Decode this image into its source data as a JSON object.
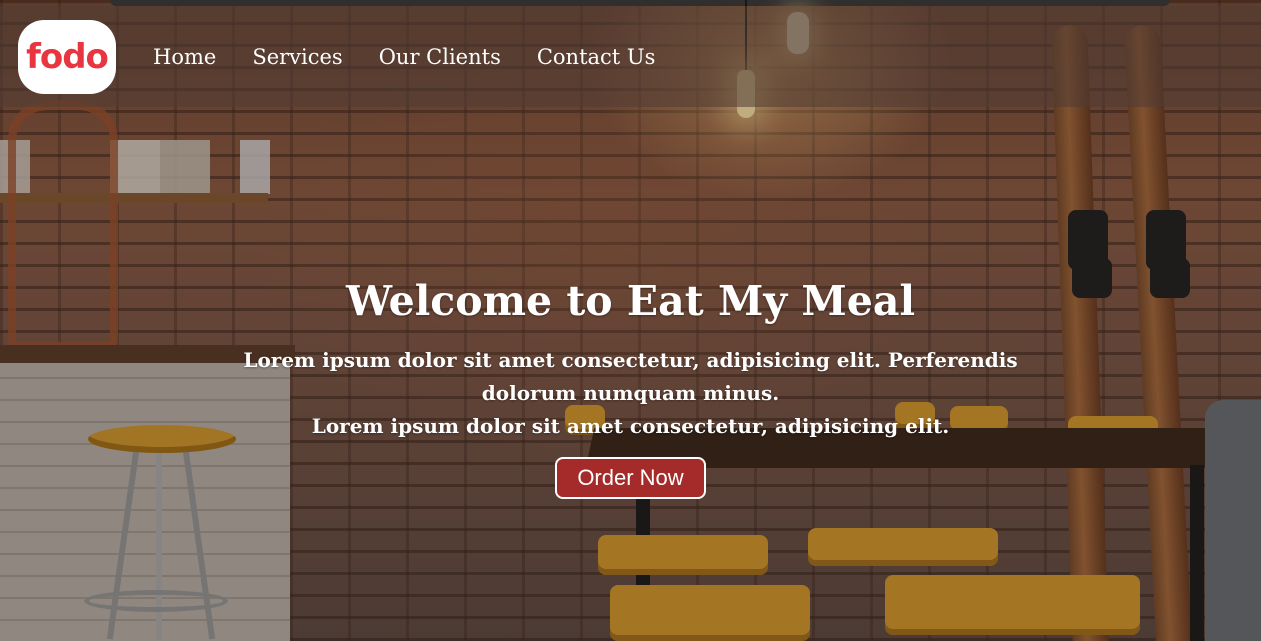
{
  "brand": {
    "logo_text": "fodo",
    "logo_color": "#e8353f"
  },
  "nav": {
    "items": [
      {
        "label": "Home"
      },
      {
        "label": "Services"
      },
      {
        "label": "Our Clients"
      },
      {
        "label": "Contact Us"
      }
    ]
  },
  "hero": {
    "title": "Welcome to Eat My Meal",
    "line1": "Lorem ipsum dolor sit amet consectetur, adipisicing elit. Perferendis dolorum numquam minus.",
    "line2": "Lorem ipsum dolor sit amet consectetur, adipisicing elit.",
    "button_label": "Order Now",
    "button_color": "#a52a2a"
  }
}
